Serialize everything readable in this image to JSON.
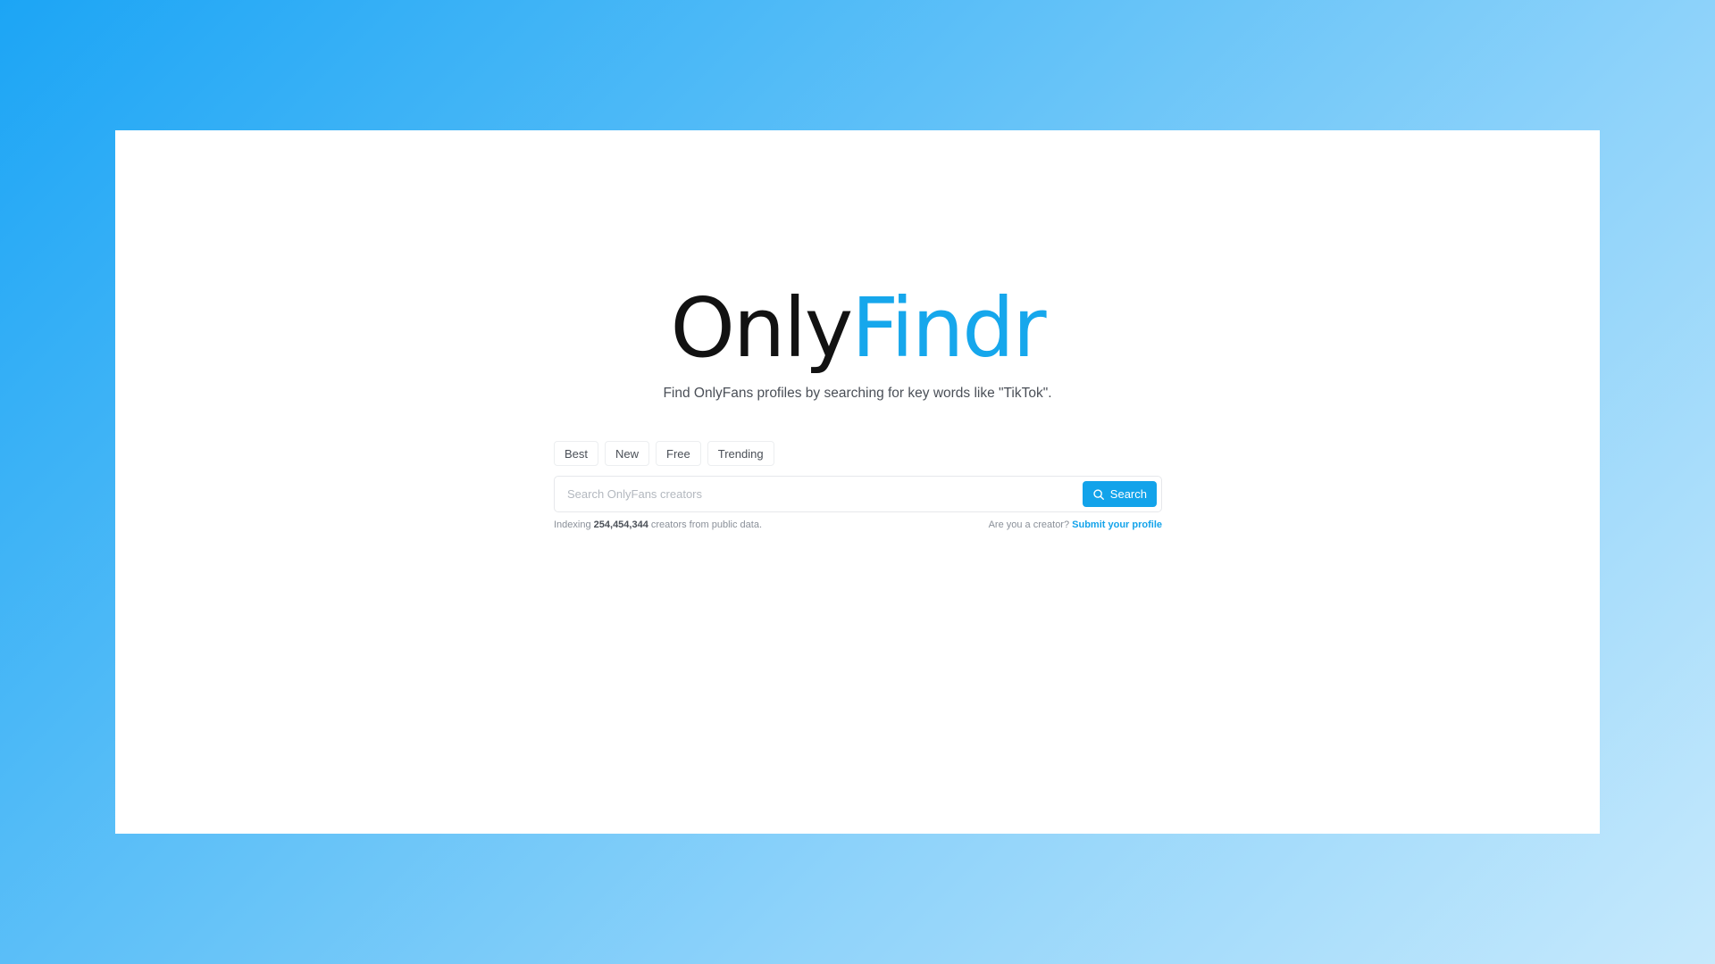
{
  "logo": {
    "part1": "Only",
    "part2": "Findr"
  },
  "tagline": "Find OnlyFans profiles by searching for key words like \"TikTok\".",
  "tabs": [
    {
      "label": "Best"
    },
    {
      "label": "New"
    },
    {
      "label": "Free"
    },
    {
      "label": "Trending"
    }
  ],
  "search": {
    "placeholder": "Search OnlyFans creators",
    "button_label": "Search",
    "button_icon": "search-icon"
  },
  "stats": {
    "prefix": "Indexing",
    "count": "254,454,344",
    "suffix": "creators from public data."
  },
  "creator_cta": {
    "question": "Are you a creator?",
    "link_label": "Submit your profile"
  },
  "colors": {
    "accent": "#13a3ea",
    "logo_dark": "#121212",
    "logo_blue": "#16a7ec"
  }
}
